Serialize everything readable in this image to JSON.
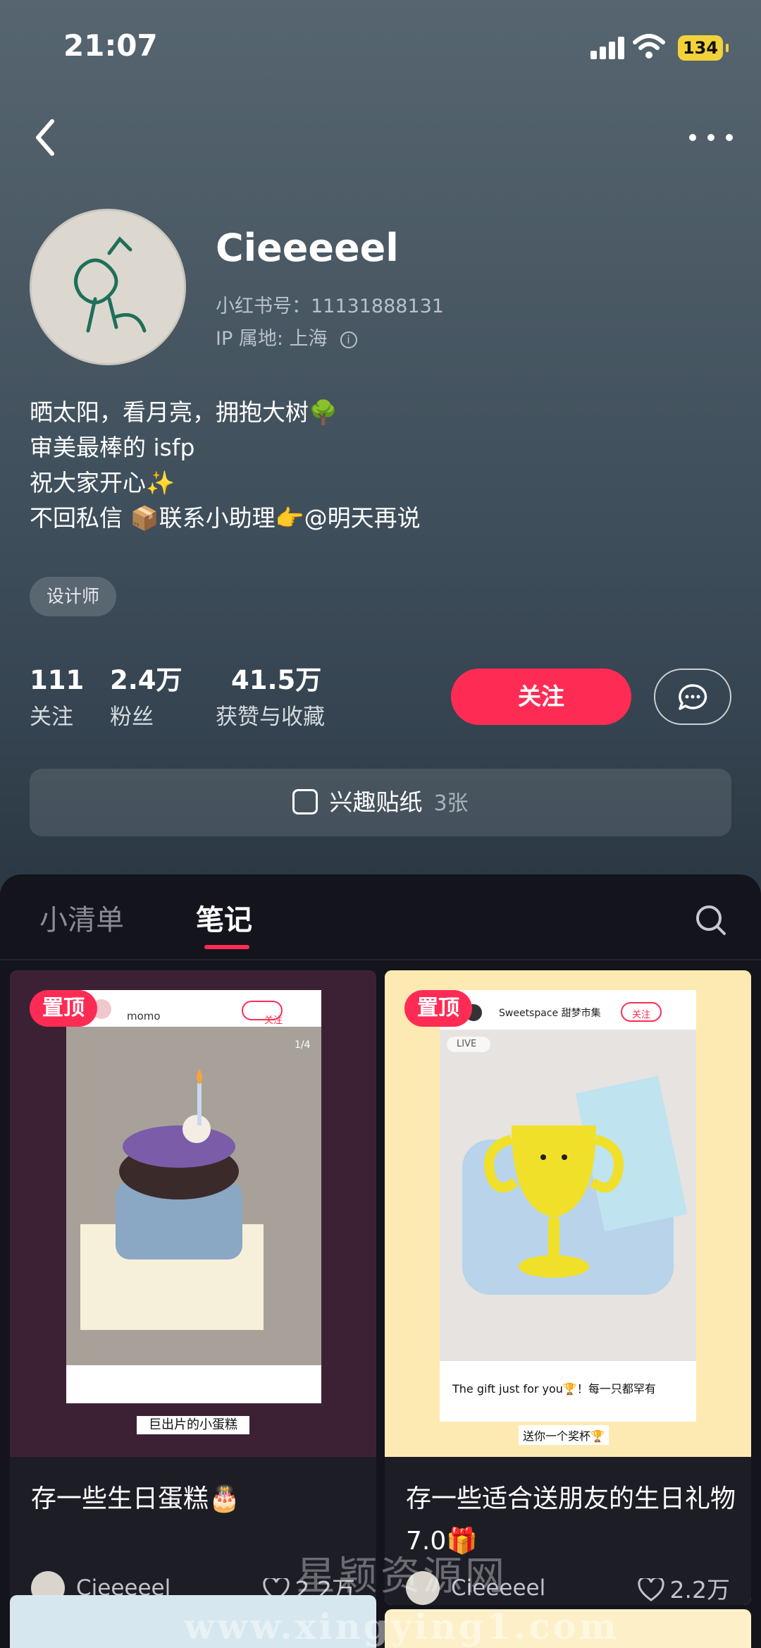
{
  "status_bar": {
    "time": "21:07",
    "battery": "134"
  },
  "profile": {
    "name": "Cieeeeel",
    "id_line": "小红书号：11131888131",
    "ip_line": "IP 属地: 上海",
    "bio": [
      "晒太阳，看月亮，拥抱大树🌳",
      "审美最棒的 isfp",
      "祝大家开心✨",
      "不回私信 📦联系小助理👉@明天再说"
    ],
    "tag": "设计师"
  },
  "stats": [
    {
      "value": "111",
      "label": "关注"
    },
    {
      "value": "2.4万",
      "label": "粉丝"
    },
    {
      "value": "41.5万",
      "label": "获赞与收藏"
    }
  ],
  "actions": {
    "follow_label": "关注"
  },
  "sticker_bar": {
    "label": "兴趣贴纸",
    "count": "3张"
  },
  "tabs": {
    "items": [
      "小清单",
      "笔记"
    ],
    "active": "笔记"
  },
  "notes": [
    {
      "pin": "置顶",
      "cover_user": "momo",
      "cover_follow": "关注",
      "cover_page": "1/4",
      "cover_caption": "巨出片的小蛋糕",
      "title": "存一些生日蛋糕🎂",
      "author": "Cieeeeel",
      "likes": "2.2万"
    },
    {
      "pin": "置顶",
      "cover_user": "Sweetspace 甜梦市集",
      "cover_follow": "关注",
      "cover_live": "LIVE",
      "cover_line": "The gift just for you🏆！每一只都罕有",
      "cover_caption": "送你一个奖杯🏆",
      "title": "存一些适合送朋友的生日礼物7.0🎁",
      "author": "Cieeeeel",
      "likes": "2.2万"
    }
  ],
  "watermark": {
    "text": "星颖资源网",
    "url": "www.xingying1.com"
  },
  "colors": {
    "accent": "#fe2c55",
    "panel": "#14141d"
  }
}
